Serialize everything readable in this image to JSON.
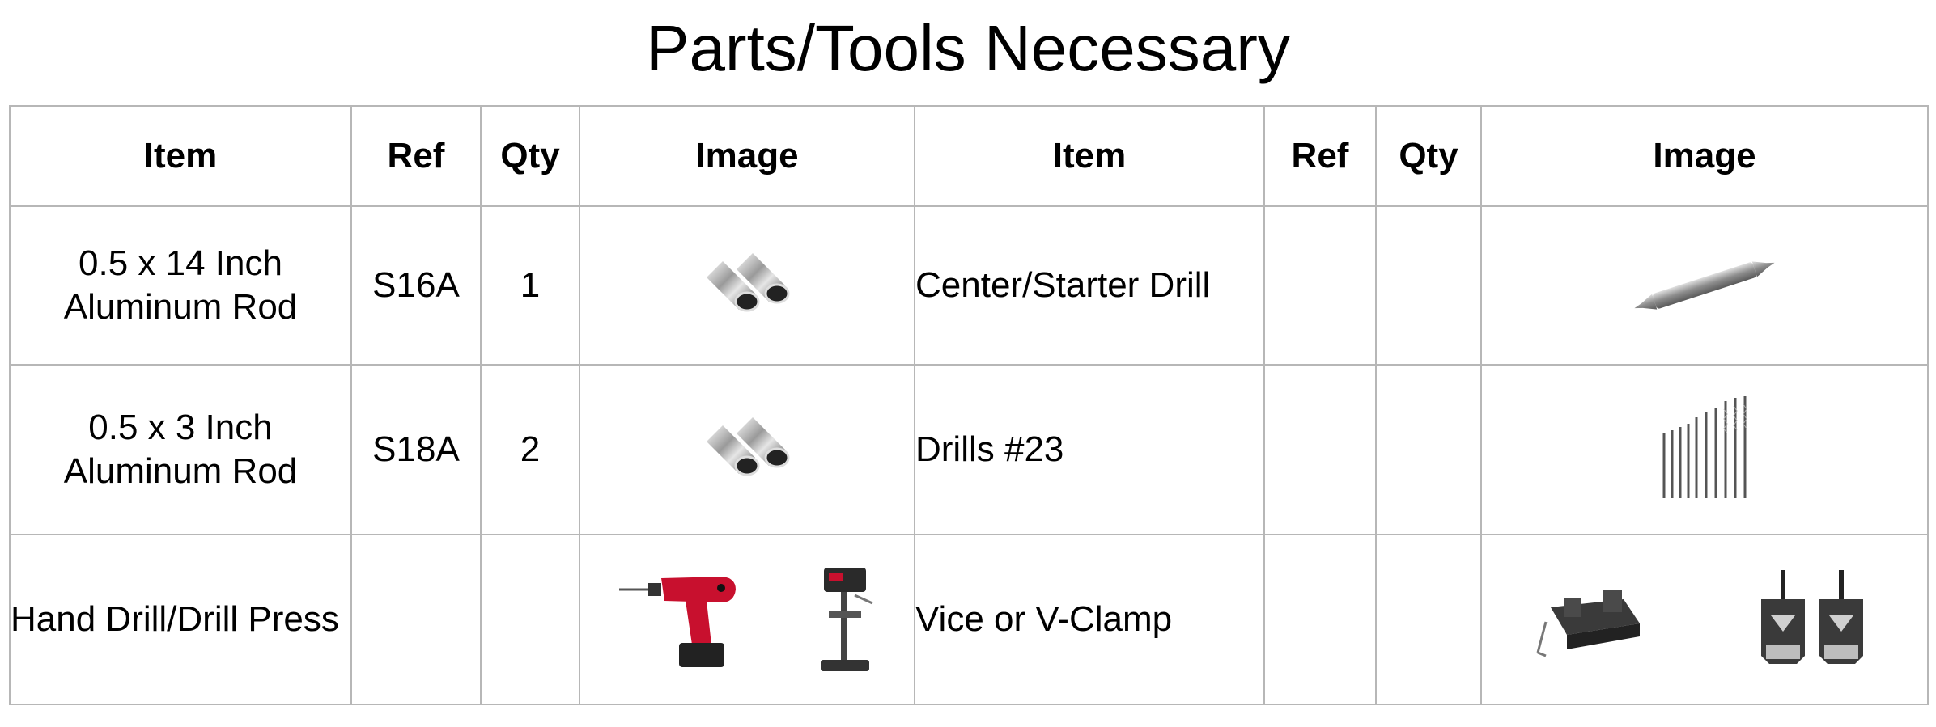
{
  "title": "Parts/Tools Necessary",
  "table": {
    "headers": [
      "Item",
      "Ref",
      "Qty",
      "Image",
      "Item",
      "Ref",
      "Qty",
      "Image"
    ],
    "rows": [
      {
        "left": {
          "item": "0.5 x 14 Inch Aluminum Rod",
          "ref": "S16A",
          "qty": "1",
          "image_icon": "aluminum-rods-icon"
        },
        "right": {
          "item": "Center/Starter Drill",
          "ref": "",
          "qty": "",
          "image_icon": "center-drill-icon"
        }
      },
      {
        "left": {
          "item": "0.5 x 3 Inch Aluminum Rod",
          "ref": "S18A",
          "qty": "2",
          "image_icon": "aluminum-rods-icon"
        },
        "right": {
          "item": "Drills #23",
          "ref": "",
          "qty": "",
          "image_icon": "drill-bits-icon"
        }
      },
      {
        "left": {
          "item": "Hand Drill/Drill Press",
          "ref": "",
          "qty": "",
          "image_icons": [
            "hand-drill-icon",
            "drill-press-icon"
          ]
        },
        "right": {
          "item": "Vice or V-Clamp",
          "ref": "",
          "qty": "",
          "image_icons": [
            "vice-icon",
            "v-clamp-icon"
          ]
        }
      }
    ]
  },
  "colors": {
    "border": "#b7b7b7",
    "drill_red": "#c8102e",
    "metal": "#9a9a9a"
  }
}
